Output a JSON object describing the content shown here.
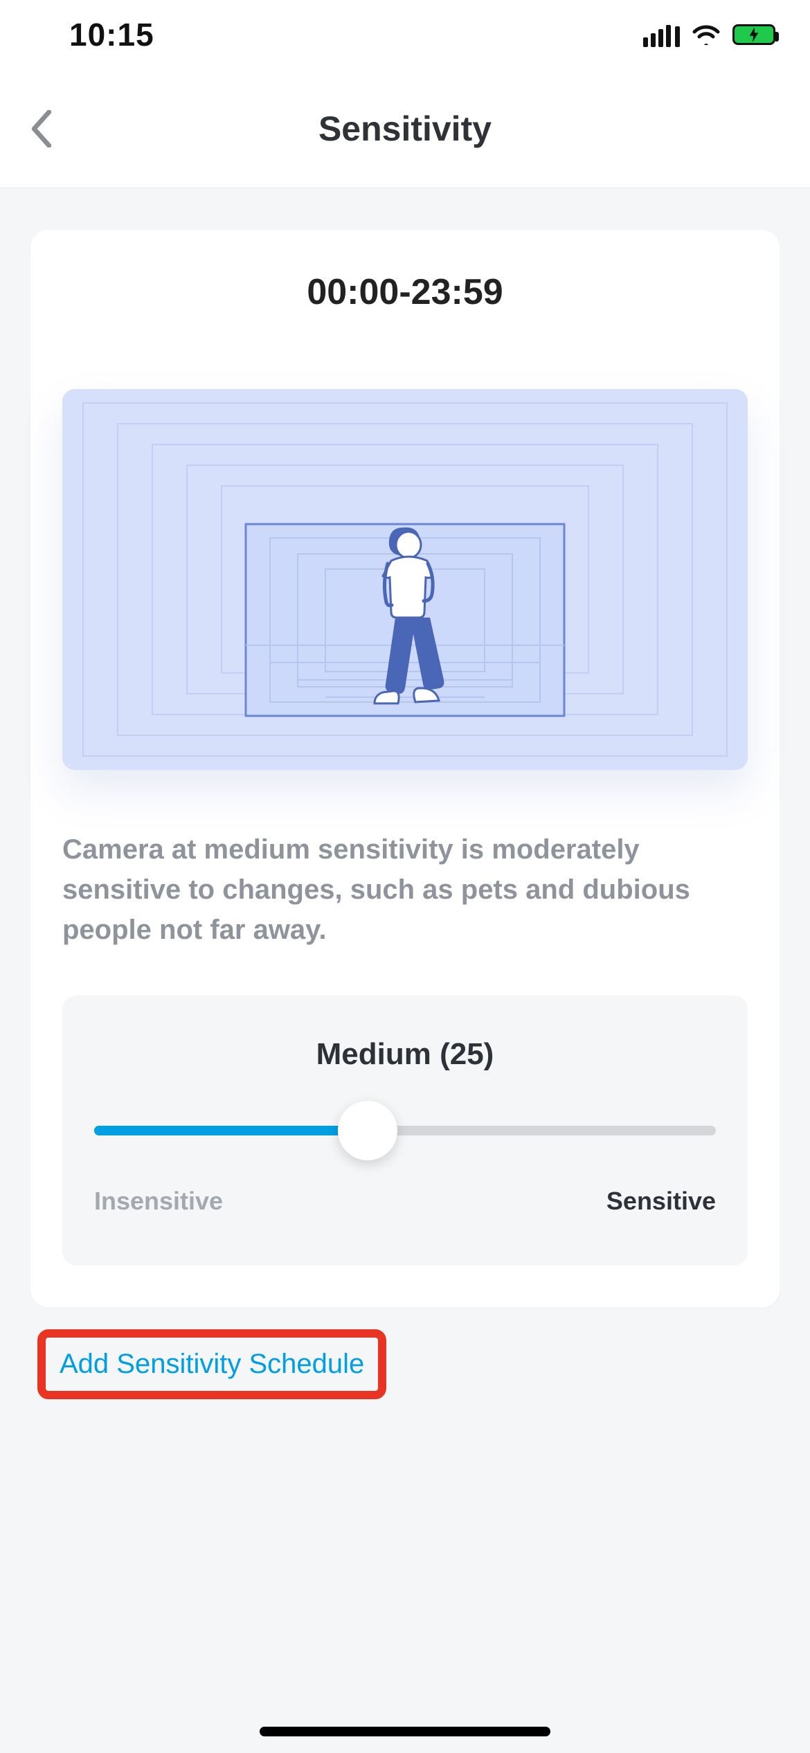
{
  "status": {
    "time": "10:15"
  },
  "nav": {
    "title": "Sensitivity"
  },
  "card": {
    "time_range": "00:00-23:59",
    "description": "Camera at medium sensitivity is moderately sensitive to changes, such as pets and dubious people not far away."
  },
  "slider": {
    "title": "Medium (25)",
    "value": 25,
    "left_label": "Insensitive",
    "right_label": "Sensitive"
  },
  "actions": {
    "add_schedule": "Add Sensitivity Schedule"
  },
  "colors": {
    "accent": "#009ee3",
    "highlight_box": "#e93323",
    "battery_green": "#1ec94b",
    "illustration_bg": "#d7e0fa",
    "figure_blue": "#4a66b7"
  }
}
